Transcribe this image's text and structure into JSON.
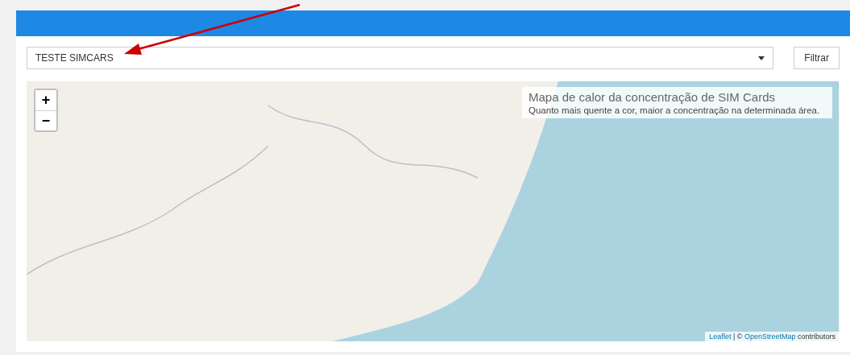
{
  "filter": {
    "select_value": "TESTE SIMCARS",
    "button": "Filtrar"
  },
  "map": {
    "zoom_in": "+",
    "zoom_out": "−",
    "legend": {
      "title": "Mapa de calor da concentração de SIM Cards",
      "subtitle": "Quanto mais quente a cor, maior a concentração na determinada área."
    },
    "attribution": {
      "link_1": "Leaflet",
      "separator": "| ©",
      "link_2": "OpenStreetMap",
      "suffix": "contributors"
    }
  }
}
